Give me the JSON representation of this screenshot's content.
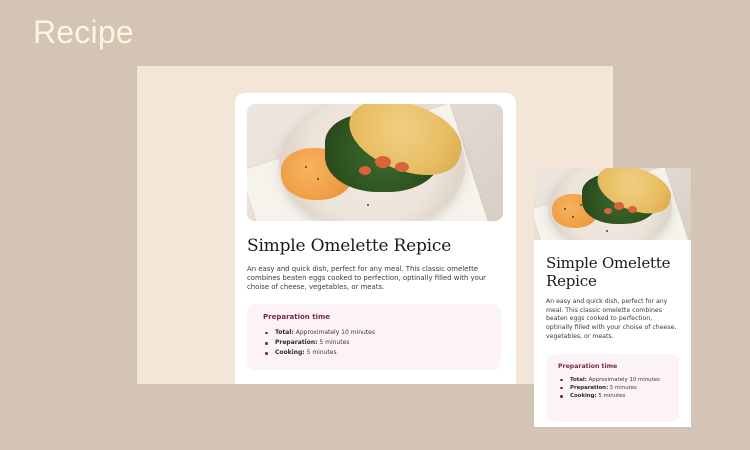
{
  "header": {
    "title": "Recipe"
  },
  "recipe": {
    "title": "Simple Omelette Repice",
    "description": "An easy and quick dish, perfect for any meal. This classic omelette combines beaten eggs cooked to perfection, optinally filled with your choise of cheese, vegetables, or meats.",
    "image_alt": "omelette-with-greens-photo",
    "preparation": {
      "title": "Preparation time",
      "items": [
        {
          "label": "Total:",
          "value": "Approximately 10 minutes"
        },
        {
          "label": "Preparation:",
          "value": "5 minutes"
        },
        {
          "label": "Cooking:",
          "value": "5 minutes"
        }
      ]
    }
  },
  "colors": {
    "page_background": "#d4c4b5",
    "desktop_frame": "#f3e5d8",
    "card": "#ffffff",
    "accent": "#7a284b",
    "prep_background": "#fcf3f7",
    "header_text": "#fff4dc"
  }
}
